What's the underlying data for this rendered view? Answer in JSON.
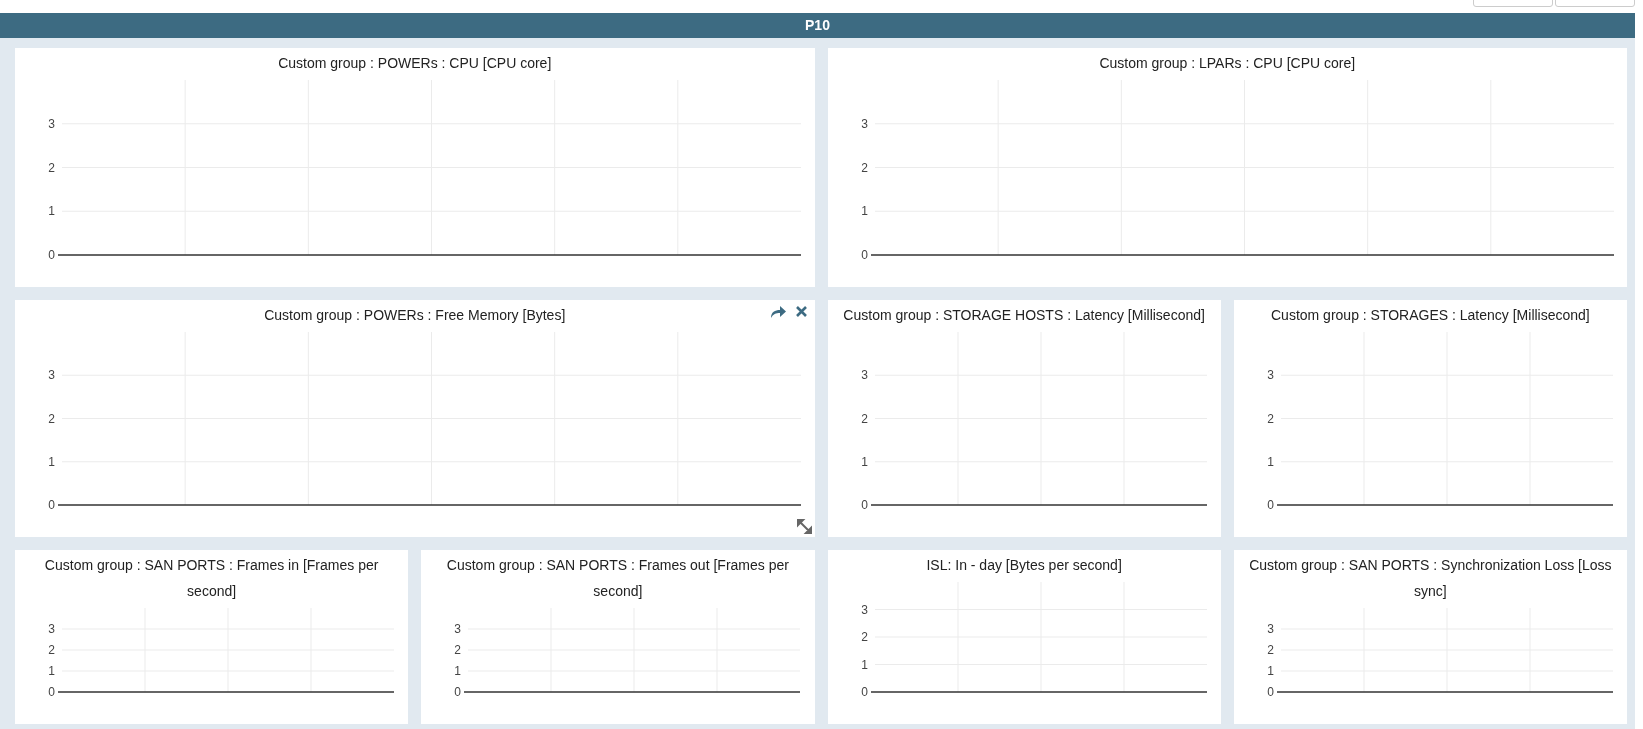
{
  "header": {
    "title": "P10"
  },
  "rows": [
    {
      "panels": [
        {
          "kind": "wide",
          "hovered": false,
          "chart_data": {
            "type": "line",
            "title": "Custom group : POWERs : CPU [CPU core]",
            "categories": [
              null,
              null,
              null,
              null,
              null,
              null,
              null
            ],
            "ylim": [
              0,
              4
            ],
            "yticks": [
              0,
              1,
              2,
              3
            ],
            "grid": true
          }
        },
        {
          "kind": "wide",
          "hovered": false,
          "chart_data": {
            "type": "line",
            "title": "Custom group : LPARs : CPU [CPU core]",
            "categories": [
              null,
              null,
              null,
              null,
              null,
              null,
              null
            ],
            "ylim": [
              0,
              4
            ],
            "yticks": [
              0,
              1,
              2,
              3
            ],
            "grid": true
          }
        }
      ]
    },
    {
      "panels": [
        {
          "kind": "wide",
          "hovered": true,
          "chart_data": {
            "type": "line",
            "title": "Custom group : POWERs : Free Memory [Bytes]",
            "categories": [
              null,
              null,
              null,
              null,
              null,
              null,
              null
            ],
            "ylim": [
              0,
              4
            ],
            "yticks": [
              0,
              1,
              2,
              3
            ],
            "grid": true
          }
        },
        {
          "kind": "narrow",
          "hovered": false,
          "chart_data": {
            "type": "line",
            "title": "Custom group : STORAGE HOSTS : Latency [Millisecond]",
            "categories": [
              null,
              null,
              null,
              null,
              null
            ],
            "ylim": [
              0,
              4
            ],
            "yticks": [
              0,
              1,
              2,
              3
            ],
            "grid": true
          }
        },
        {
          "kind": "narrow",
          "hovered": false,
          "chart_data": {
            "type": "line",
            "title": "Custom group : STORAGES : Latency [Millisecond]",
            "categories": [
              null,
              null,
              null,
              null,
              null
            ],
            "ylim": [
              0,
              4
            ],
            "yticks": [
              0,
              1,
              2,
              3
            ],
            "grid": true
          }
        }
      ]
    },
    {
      "panels": [
        {
          "kind": "narrow",
          "hovered": false,
          "chart_data": {
            "type": "line",
            "title": "Custom group : SAN PORTS : Frames in [Frames per second]",
            "categories": [
              null,
              null,
              null,
              null,
              null
            ],
            "ylim": [
              0,
              4
            ],
            "yticks": [
              0,
              1,
              2,
              3
            ],
            "grid": true
          }
        },
        {
          "kind": "narrow",
          "hovered": false,
          "chart_data": {
            "type": "line",
            "title": "Custom group : SAN PORTS : Frames out [Frames per second]",
            "categories": [
              null,
              null,
              null,
              null,
              null
            ],
            "ylim": [
              0,
              4
            ],
            "yticks": [
              0,
              1,
              2,
              3
            ],
            "grid": true
          }
        },
        {
          "kind": "narrow",
          "hovered": false,
          "chart_data": {
            "type": "line",
            "title": "ISL: In - day [Bytes per second]",
            "categories": [
              null,
              null,
              null,
              null,
              null
            ],
            "ylim": [
              0,
              4
            ],
            "yticks": [
              0,
              1,
              2,
              3
            ],
            "grid": true
          }
        },
        {
          "kind": "narrow",
          "hovered": false,
          "chart_data": {
            "type": "line",
            "title": "Custom group : SAN PORTS : Synchronization Loss [Loss sync]",
            "categories": [
              null,
              null,
              null,
              null,
              null
            ],
            "ylim": [
              0,
              4
            ],
            "yticks": [
              0,
              1,
              2,
              3
            ],
            "grid": true
          }
        }
      ]
    }
  ]
}
